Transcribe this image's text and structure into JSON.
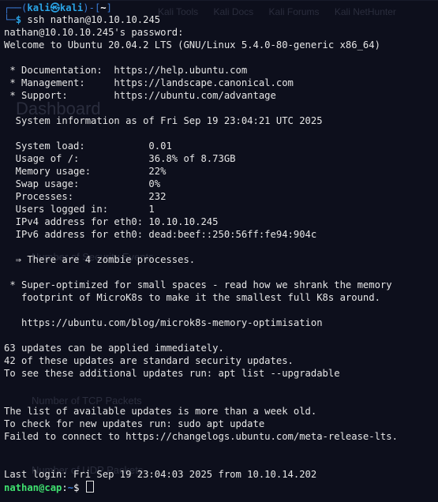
{
  "prompt": {
    "top_prefix": "┌──(",
    "user": "kali",
    "at_symbol": "㉿",
    "host": "kali",
    "suffix": ")-[",
    "cwd": "~",
    "close": "]",
    "bottom_prefix": "└─",
    "dollar": "$",
    "command_name": "ssh",
    "command_args": " nathan@10.10.10.245"
  },
  "ghost": {
    "top_tabs": [
      "Kali Tools",
      "Kali Docs",
      "Kali Forums",
      "Kali NetHunter"
    ],
    "heading": "Dashboard",
    "label_1": "Number of Security Events",
    "label_2": "Number of TCP Packets",
    "label_3": "Number of UDP Packets"
  },
  "output_lines": [
    "nathan@10.10.10.245's password:",
    "Welcome to Ubuntu 20.04.2 LTS (GNU/Linux 5.4.0-80-generic x86_64)",
    "",
    " * Documentation:  https://help.ubuntu.com",
    " * Management:     https://landscape.canonical.com",
    " * Support:        https://ubuntu.com/advantage",
    "",
    "  System information as of Fri Sep 19 23:04:21 UTC 2025",
    "",
    "  System load:           0.01",
    "  Usage of /:            36.8% of 8.73GB",
    "  Memory usage:          22%",
    "  Swap usage:            0%",
    "  Processes:             232",
    "  Users logged in:       1",
    "  IPv4 address for eth0: 10.10.10.245",
    "  IPv6 address for eth0: dead:beef::250:56ff:fe94:904c",
    "",
    "  ⇒ There are 4 zombie processes.",
    "",
    " * Super-optimized for small spaces - read how we shrank the memory",
    "   footprint of MicroK8s to make it the smallest full K8s around.",
    "",
    "   https://ubuntu.com/blog/microk8s-memory-optimisation",
    "",
    "63 updates can be applied immediately.",
    "42 of these updates are standard security updates.",
    "To see these additional updates run: apt list --upgradable",
    "",
    "",
    "The list of available updates is more than a week old.",
    "To check for new updates run: sudo apt update",
    "Failed to connect to https://changelogs.ubuntu.com/meta-release-lts.",
    "",
    "",
    "Last login: Fri Sep 19 23:04:03 2025 from 10.10.14.202"
  ],
  "remote_prompt": {
    "user_host": "nathan@cap",
    "separator": ":",
    "cwd": "~",
    "dollar": "$ "
  }
}
